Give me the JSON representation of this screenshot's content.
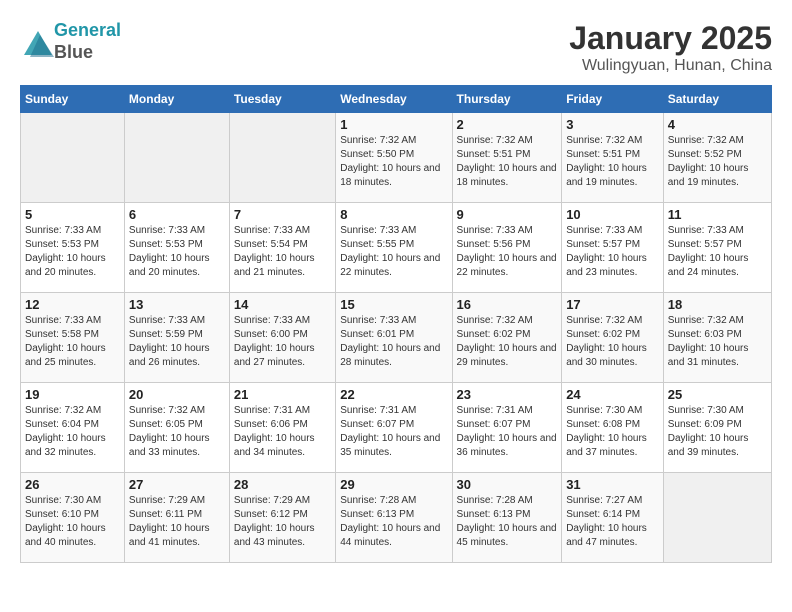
{
  "logo": {
    "line1": "General",
    "line2": "Blue"
  },
  "title": "January 2025",
  "subtitle": "Wulingyuan, Hunan, China",
  "days_of_week": [
    "Sunday",
    "Monday",
    "Tuesday",
    "Wednesday",
    "Thursday",
    "Friday",
    "Saturday"
  ],
  "weeks": [
    [
      {
        "day": "",
        "empty": true
      },
      {
        "day": "",
        "empty": true
      },
      {
        "day": "",
        "empty": true
      },
      {
        "day": "1",
        "sunrise": "7:32 AM",
        "sunset": "5:50 PM",
        "daylight": "10 hours and 18 minutes."
      },
      {
        "day": "2",
        "sunrise": "7:32 AM",
        "sunset": "5:51 PM",
        "daylight": "10 hours and 18 minutes."
      },
      {
        "day": "3",
        "sunrise": "7:32 AM",
        "sunset": "5:51 PM",
        "daylight": "10 hours and 19 minutes."
      },
      {
        "day": "4",
        "sunrise": "7:32 AM",
        "sunset": "5:52 PM",
        "daylight": "10 hours and 19 minutes."
      }
    ],
    [
      {
        "day": "5",
        "sunrise": "7:33 AM",
        "sunset": "5:53 PM",
        "daylight": "10 hours and 20 minutes."
      },
      {
        "day": "6",
        "sunrise": "7:33 AM",
        "sunset": "5:53 PM",
        "daylight": "10 hours and 20 minutes."
      },
      {
        "day": "7",
        "sunrise": "7:33 AM",
        "sunset": "5:54 PM",
        "daylight": "10 hours and 21 minutes."
      },
      {
        "day": "8",
        "sunrise": "7:33 AM",
        "sunset": "5:55 PM",
        "daylight": "10 hours and 22 minutes."
      },
      {
        "day": "9",
        "sunrise": "7:33 AM",
        "sunset": "5:56 PM",
        "daylight": "10 hours and 22 minutes."
      },
      {
        "day": "10",
        "sunrise": "7:33 AM",
        "sunset": "5:57 PM",
        "daylight": "10 hours and 23 minutes."
      },
      {
        "day": "11",
        "sunrise": "7:33 AM",
        "sunset": "5:57 PM",
        "daylight": "10 hours and 24 minutes."
      }
    ],
    [
      {
        "day": "12",
        "sunrise": "7:33 AM",
        "sunset": "5:58 PM",
        "daylight": "10 hours and 25 minutes."
      },
      {
        "day": "13",
        "sunrise": "7:33 AM",
        "sunset": "5:59 PM",
        "daylight": "10 hours and 26 minutes."
      },
      {
        "day": "14",
        "sunrise": "7:33 AM",
        "sunset": "6:00 PM",
        "daylight": "10 hours and 27 minutes."
      },
      {
        "day": "15",
        "sunrise": "7:33 AM",
        "sunset": "6:01 PM",
        "daylight": "10 hours and 28 minutes."
      },
      {
        "day": "16",
        "sunrise": "7:32 AM",
        "sunset": "6:02 PM",
        "daylight": "10 hours and 29 minutes."
      },
      {
        "day": "17",
        "sunrise": "7:32 AM",
        "sunset": "6:02 PM",
        "daylight": "10 hours and 30 minutes."
      },
      {
        "day": "18",
        "sunrise": "7:32 AM",
        "sunset": "6:03 PM",
        "daylight": "10 hours and 31 minutes."
      }
    ],
    [
      {
        "day": "19",
        "sunrise": "7:32 AM",
        "sunset": "6:04 PM",
        "daylight": "10 hours and 32 minutes."
      },
      {
        "day": "20",
        "sunrise": "7:32 AM",
        "sunset": "6:05 PM",
        "daylight": "10 hours and 33 minutes."
      },
      {
        "day": "21",
        "sunrise": "7:31 AM",
        "sunset": "6:06 PM",
        "daylight": "10 hours and 34 minutes."
      },
      {
        "day": "22",
        "sunrise": "7:31 AM",
        "sunset": "6:07 PM",
        "daylight": "10 hours and 35 minutes."
      },
      {
        "day": "23",
        "sunrise": "7:31 AM",
        "sunset": "6:07 PM",
        "daylight": "10 hours and 36 minutes."
      },
      {
        "day": "24",
        "sunrise": "7:30 AM",
        "sunset": "6:08 PM",
        "daylight": "10 hours and 37 minutes."
      },
      {
        "day": "25",
        "sunrise": "7:30 AM",
        "sunset": "6:09 PM",
        "daylight": "10 hours and 39 minutes."
      }
    ],
    [
      {
        "day": "26",
        "sunrise": "7:30 AM",
        "sunset": "6:10 PM",
        "daylight": "10 hours and 40 minutes."
      },
      {
        "day": "27",
        "sunrise": "7:29 AM",
        "sunset": "6:11 PM",
        "daylight": "10 hours and 41 minutes."
      },
      {
        "day": "28",
        "sunrise": "7:29 AM",
        "sunset": "6:12 PM",
        "daylight": "10 hours and 43 minutes."
      },
      {
        "day": "29",
        "sunrise": "7:28 AM",
        "sunset": "6:13 PM",
        "daylight": "10 hours and 44 minutes."
      },
      {
        "day": "30",
        "sunrise": "7:28 AM",
        "sunset": "6:13 PM",
        "daylight": "10 hours and 45 minutes."
      },
      {
        "day": "31",
        "sunrise": "7:27 AM",
        "sunset": "6:14 PM",
        "daylight": "10 hours and 47 minutes."
      },
      {
        "day": "",
        "empty": true
      }
    ]
  ]
}
